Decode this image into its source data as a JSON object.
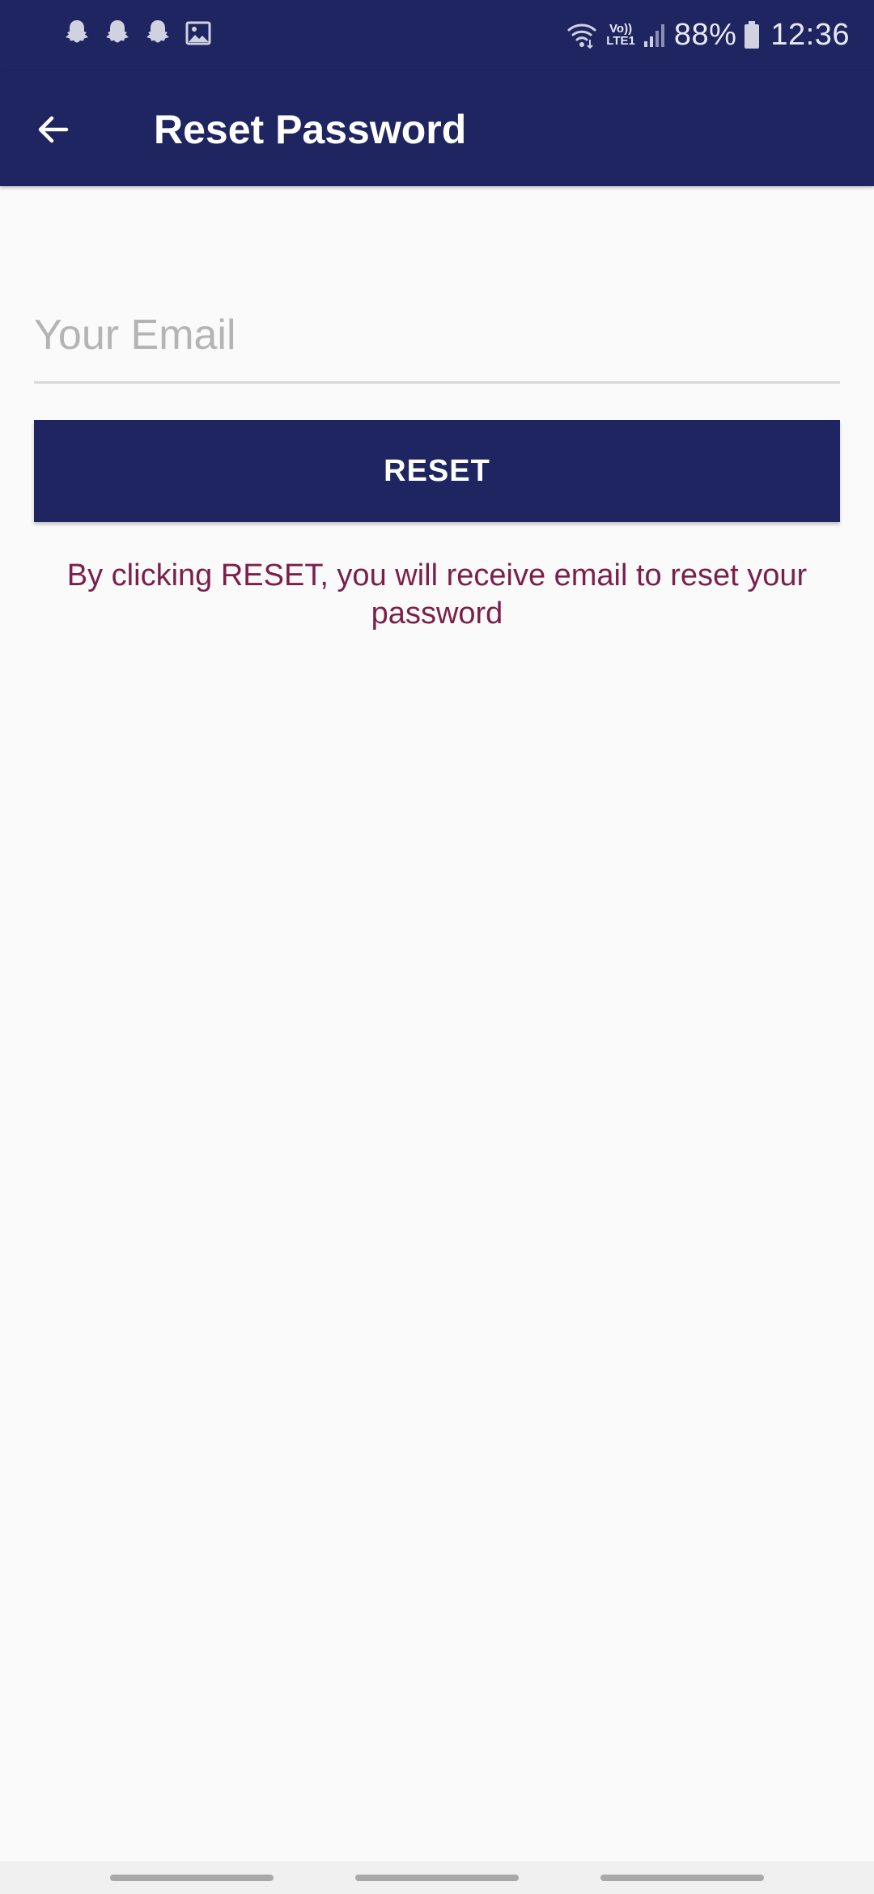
{
  "status_bar": {
    "notification_icons": [
      "snapchat-icon",
      "snapchat-icon",
      "snapchat-icon",
      "image-icon"
    ],
    "network_label_top": "Vo))",
    "network_label_bottom": "LTE1",
    "battery_percent": "88%",
    "time": "12:36"
  },
  "app_bar": {
    "back_icon": "arrow-left-icon",
    "title": "Reset Password"
  },
  "form": {
    "email_placeholder": "Your Email",
    "email_value": "",
    "reset_label": "RESET",
    "info_text": "By clicking RESET, you will receive email to reset your password"
  },
  "colors": {
    "primary": "#1e2560",
    "info_text": "#7b1f4a",
    "background": "#fafafa",
    "placeholder": "#b4b4b4"
  }
}
